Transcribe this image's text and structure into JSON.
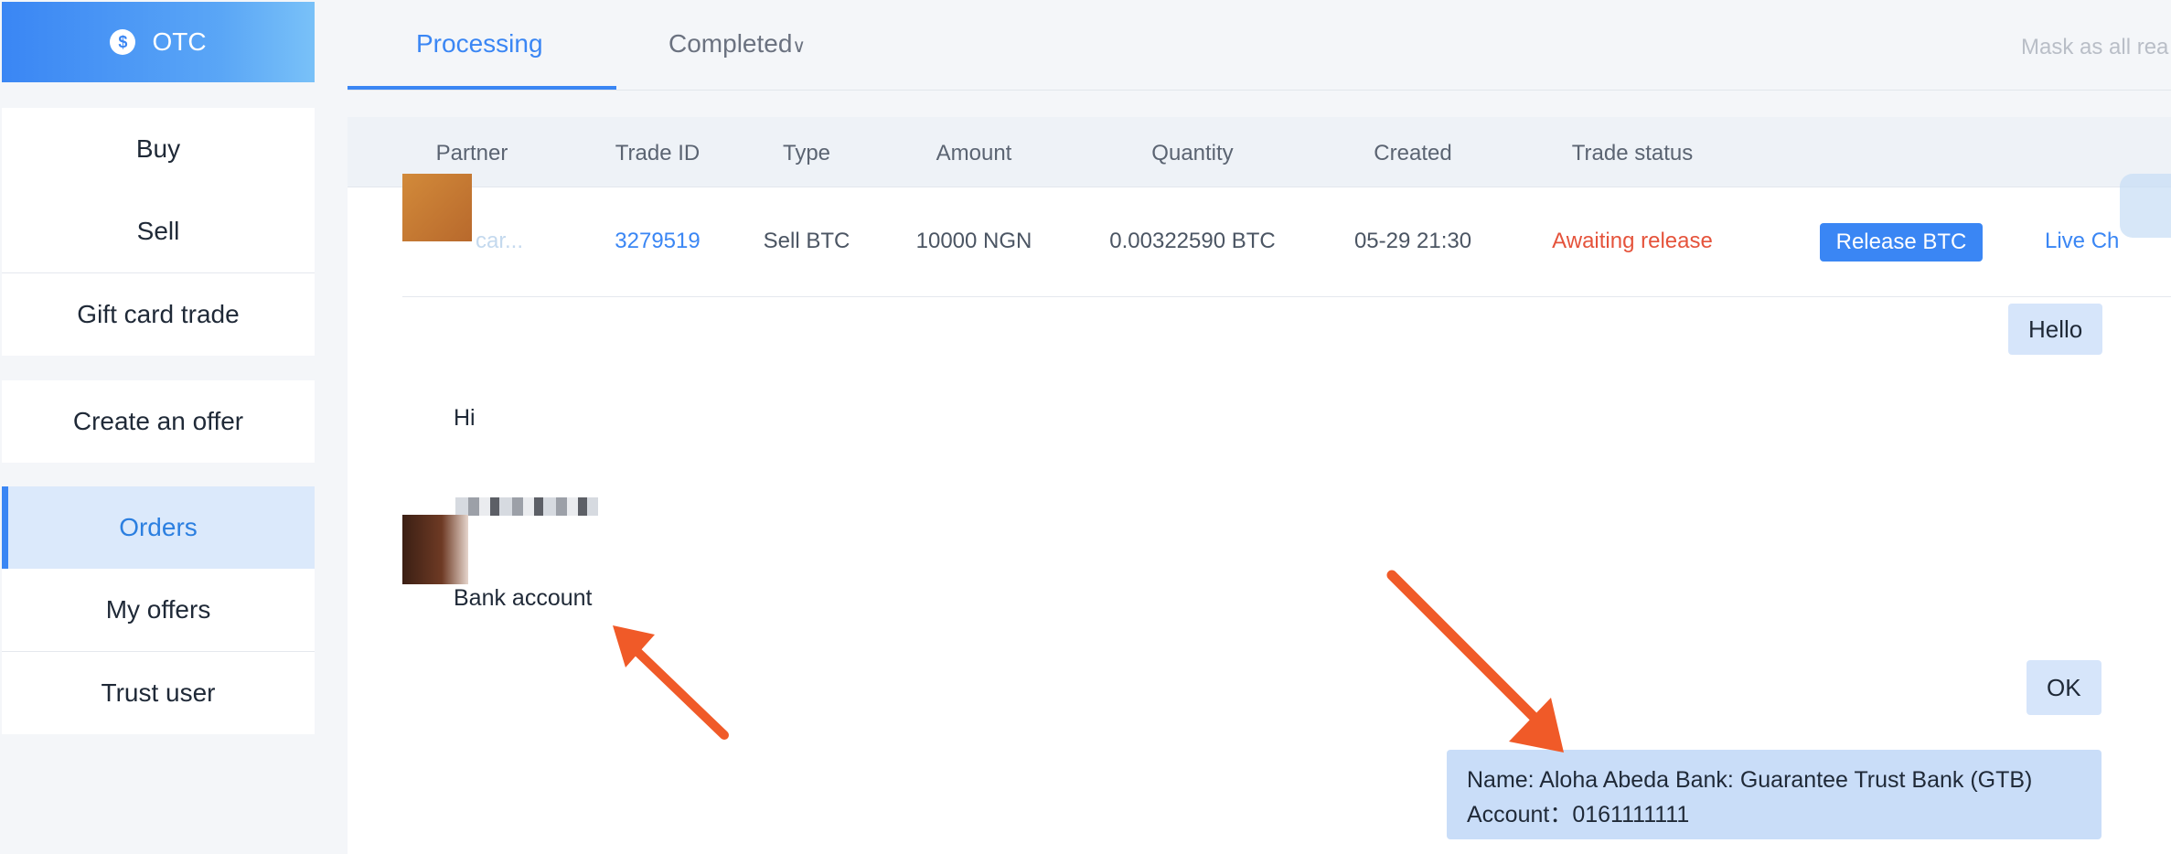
{
  "sidebar": {
    "header_label": "OTC",
    "header_icon": "dollar-coin-icon",
    "group1": [
      {
        "label": "Buy"
      },
      {
        "label": "Sell"
      },
      {
        "label": "Gift card trade"
      }
    ],
    "group2": [
      {
        "label": "Create an offer"
      }
    ],
    "group3": [
      {
        "label": "Orders",
        "active": true
      },
      {
        "label": "My offers"
      },
      {
        "label": "Trust user"
      }
    ]
  },
  "tabs": {
    "processing": "Processing",
    "completed": "Completed",
    "mask_all_read": "Mask as all rea"
  },
  "table": {
    "headers": [
      "Partner",
      "Trade ID",
      "Type",
      "Amount",
      "Quantity",
      "Created",
      "Trade status"
    ],
    "row": {
      "partner": "car...",
      "trade_id": "3279519",
      "type": "Sell BTC",
      "amount": "10000 NGN",
      "quantity": "0.00322590 BTC",
      "created": "05-29 21:30",
      "status": "Awaiting release",
      "action": "Release BTC",
      "chat_link": "Live Ch"
    }
  },
  "chat": {
    "msg_hello": "Hello",
    "msg_hi": "Hi",
    "msg_bank_account": "Bank account",
    "msg_ok": "OK",
    "bank_name_line": "Name: Aloha Abeda Bank: Guarantee Trust Bank (GTB)",
    "bank_account_line": "Account：0161111111"
  },
  "colors": {
    "accent": "#3a86f4",
    "status_red": "#e5533b",
    "annotation_arrow": "#f05a28"
  }
}
